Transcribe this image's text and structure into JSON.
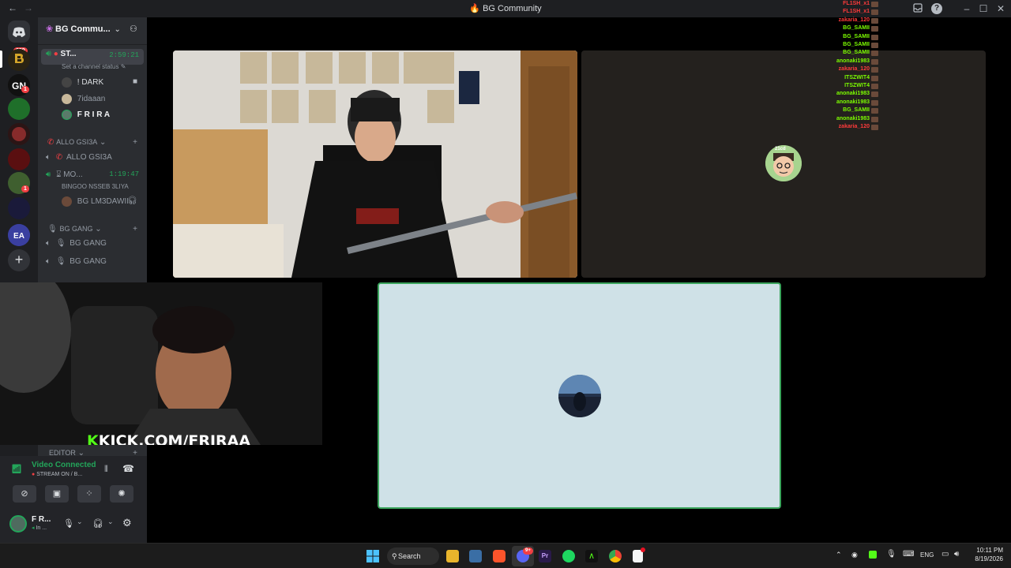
{
  "window": {
    "title": "BG Community",
    "back": "←",
    "forward": "→"
  },
  "servers": {
    "home_badge": "289",
    "badges": [
      "1",
      "1"
    ],
    "add_label": "+"
  },
  "server_header": {
    "name": "BG Commu..."
  },
  "channels": {
    "stream_channel": {
      "name": "ST...",
      "timer": "2:59:21",
      "status_hint": "Set a channel status"
    },
    "stream_members": [
      "! DARK",
      "7idaaan",
      "F R I R A"
    ],
    "cat_allo": "ALLO GSI3A",
    "allo_channel": "ALLO GSI3A",
    "mo_channel": {
      "name": "MO...",
      "timer": "1:19:47",
      "sub": "BINGOO NSSEB 3LIYA"
    },
    "mo_member": "BG LM3DAWII",
    "cat_bg_gang": "BG GANG",
    "bg_gang_1": "BG GANG",
    "bg_gang_2": "BG GANG",
    "cat_editor": "EDITOR"
  },
  "voice_panel": {
    "status": "Video Connected",
    "sub": "STREAM ON / B..."
  },
  "user_panel": {
    "name": "F R...",
    "status": "In ..."
  },
  "overlay": {
    "kick_url": "KICK.COM/FRIRAA",
    "kick_logo": "K"
  },
  "avatar_tile": {
    "tag": "21cd"
  },
  "chat_overlay": [
    {
      "name": "FL1SH_x1",
      "color": "#ff3b3b"
    },
    {
      "name": "FL1SH_x1",
      "color": "#ff3b3b"
    },
    {
      "name": "zakaria_120",
      "color": "#ff3b3b"
    },
    {
      "name": "BG_SAMII",
      "color": "#7cfc00"
    },
    {
      "name": "BG_SAMII",
      "color": "#7cfc00"
    },
    {
      "name": "BG_SAMII",
      "color": "#7cfc00"
    },
    {
      "name": "BG_SAMII",
      "color": "#7cfc00"
    },
    {
      "name": "anonaki1983",
      "color": "#7cfc00"
    },
    {
      "name": "zakaria_120",
      "color": "#ff3b3b"
    },
    {
      "name": "ITSZWIT4",
      "color": "#7cfc00"
    },
    {
      "name": "ITSZWIT4",
      "color": "#7cfc00"
    },
    {
      "name": "anonaki1983",
      "color": "#7cfc00"
    },
    {
      "name": "anonaki1983",
      "color": "#7cfc00"
    },
    {
      "name": "BG_SAMII",
      "color": "#7cfc00"
    },
    {
      "name": "anonaki1983",
      "color": "#7cfc00"
    },
    {
      "name": "zakaria_120",
      "color": "#ff3b3b"
    }
  ],
  "taskbar": {
    "search": "Search",
    "lang": "ENG",
    "time": "10:11 PM",
    "date": "8/19/2026",
    "discord_badge": "9+"
  },
  "colors": {
    "accent_green": "#23a55a",
    "focus_border": "#3ba55d",
    "red": "#f23f43"
  }
}
